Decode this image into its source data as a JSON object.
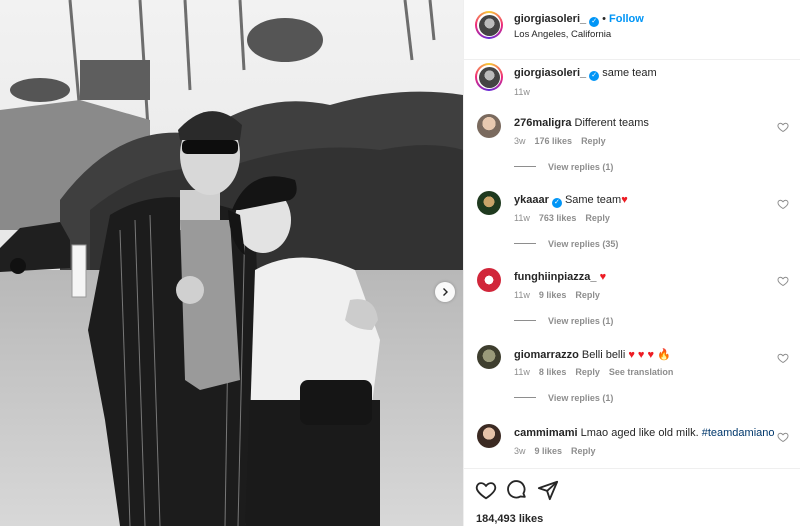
{
  "post": {
    "username": "giorgiasoleri_",
    "follow_label": "Follow",
    "location": "Los Angeles, California",
    "likes": "184,493 likes"
  },
  "caption": {
    "username": "giorgiasoleri_",
    "text": "same team",
    "time": "11w"
  },
  "comments": [
    {
      "username": "276maligra",
      "text": "Different teams",
      "time": "3w",
      "likes": "176 likes",
      "reply": "Reply",
      "view_replies": "View replies (1)",
      "verified": false
    },
    {
      "username": "ykaaar",
      "text": "Same team",
      "emoji": "♥",
      "time": "11w",
      "likes": "763 likes",
      "reply": "Reply",
      "view_replies": "View replies (35)",
      "verified": true
    },
    {
      "username": "funghiinpiazza_",
      "text": "",
      "emoji": "♥",
      "time": "11w",
      "likes": "9 likes",
      "reply": "Reply",
      "view_replies": "View replies (1)",
      "verified": false
    },
    {
      "username": "giomarrazzo",
      "text": "Belli belli",
      "emoji": "♥ ♥ ♥ 🔥",
      "time": "11w",
      "likes": "8 likes",
      "reply": "Reply",
      "translate": "See translation",
      "view_replies": "View replies (1)",
      "verified": false
    },
    {
      "username": "cammimami",
      "text": "Lmao aged like old milk.",
      "hashtag": "#teamdamiano",
      "time": "3w",
      "likes": "9 likes",
      "reply": "Reply",
      "verified": false
    }
  ],
  "icons": {
    "like": "heart-icon",
    "comment": "comment-icon",
    "share": "share-icon",
    "next": "chevron-right-icon"
  },
  "colors": {
    "accent": "#0095f6",
    "heart": "#ed1c24",
    "muted": "#8e8e8e"
  }
}
